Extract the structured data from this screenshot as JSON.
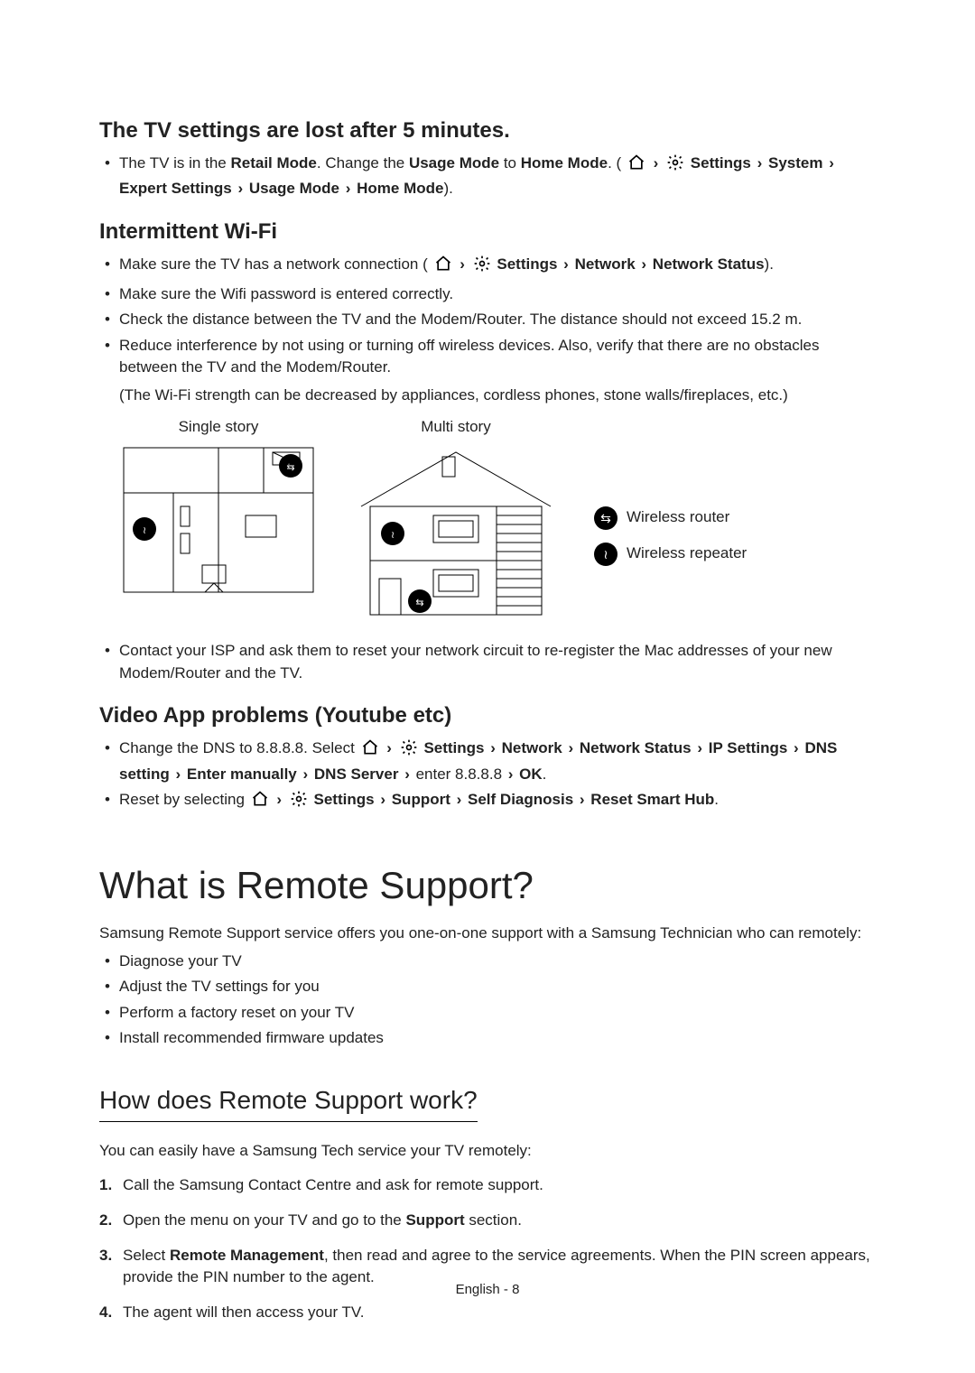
{
  "sections": {
    "tv_settings": {
      "heading": "The TV settings are lost after 5 minutes.",
      "bullet1_pre": "The TV is in the ",
      "bullet1_retail": "Retail Mode",
      "bullet1_mid1": ". Change the ",
      "bullet1_usage": "Usage Mode",
      "bullet1_mid2": " to ",
      "bullet1_home": "Home Mode",
      "bullet1_mid3": ". (",
      "path1_settings": "Settings",
      "path1_system": "System",
      "path1_expert": "Expert Settings",
      "path1_usage": "Usage Mode",
      "path1_home": "Home Mode",
      "bullet1_end": ")."
    },
    "wifi": {
      "heading": "Intermittent Wi-Fi",
      "b1_pre": "Make sure the TV has a network connection (",
      "b1_settings": "Settings",
      "b1_network": "Network",
      "b1_status": "Network Status",
      "b1_end": ").",
      "b2": "Make sure the Wifi password is entered correctly.",
      "b3": "Check the distance between the TV and the Modem/Router. The distance should not exceed 15.2 m.",
      "b4": "Reduce interference by not using or turning off wireless devices. Also, verify that there are no obstacles between the TV and the Modem/Router.",
      "note": "(The Wi-Fi strength can be decreased by appliances, cordless phones, stone walls/fireplaces, etc.)",
      "cap_single": "Single story",
      "cap_multi": "Multi story",
      "legend_router": "Wireless router",
      "legend_repeater": "Wireless repeater",
      "b5": "Contact your ISP and ask them to reset your network circuit to re-register the Mac addresses of your new Modem/Router and the TV."
    },
    "video": {
      "heading": "Video App problems (Youtube etc)",
      "b1_pre": "Change the DNS to 8.8.8.8. Select ",
      "b1_settings": "Settings",
      "b1_network": "Network",
      "b1_status": "Network Status",
      "b1_ip": "IP Settings",
      "b1_dns": "DNS setting",
      "b1_enter": "Enter manually",
      "b1_server": "DNS Server",
      "b1_mid": " enter 8.8.8.8 ",
      "b1_ok": "OK",
      "b1_end": ".",
      "b2_pre": "Reset by selecting ",
      "b2_settings": "Settings",
      "b2_support": "Support",
      "b2_self": "Self Diagnosis",
      "b2_reset": "Reset Smart Hub",
      "b2_end": "."
    },
    "remote": {
      "heading": "What is Remote Support?",
      "intro": "Samsung Remote Support service offers you one-on-one support with a Samsung Technician who can remotely:",
      "b1": "Diagnose your TV",
      "b2": "Adjust the TV settings for you",
      "b3": "Perform a factory reset on your TV",
      "b4": "Install recommended firmware updates"
    },
    "how": {
      "heading": "How does Remote Support work?",
      "intro": "You can easily have a Samsung Tech service your TV remotely:",
      "s1": "Call the Samsung Contact Centre and ask for remote support.",
      "s2_pre": "Open the menu on your TV and go to the ",
      "s2_bold": "Support",
      "s2_end": " section.",
      "s3_pre": "Select ",
      "s3_bold": "Remote Management",
      "s3_end": ", then read and agree to the service agreements. When the PIN screen appears, provide the PIN number to the agent.",
      "s4": "The agent will then access your TV."
    }
  },
  "footer": "English - 8",
  "icons": {
    "home": "home-icon",
    "gear": "gear-icon"
  }
}
